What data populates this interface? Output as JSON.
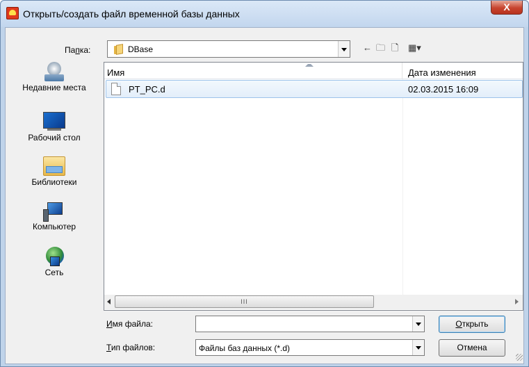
{
  "window": {
    "title": "Открыть/создать файл временной базы данных",
    "close_glyph": "X"
  },
  "lookin": {
    "label_pre": "Па",
    "label_accel": "п",
    "label_post": "ка:",
    "value": "DBase"
  },
  "toolbar": {
    "back_glyph": "←",
    "up_glyph": "🗀",
    "newfolder_glyph": "🗋",
    "views_glyph": "▦▾",
    "icons": [
      "back-icon",
      "up-folder-icon",
      "new-folder-icon",
      "view-menu-icon"
    ]
  },
  "places": [
    {
      "label": "Недавние места",
      "icon": "recent-places-icon"
    },
    {
      "label": "Рабочий стол",
      "icon": "desktop-icon"
    },
    {
      "label": "Библиотеки",
      "icon": "libraries-icon"
    },
    {
      "label": "Компьютер",
      "icon": "computer-icon"
    },
    {
      "label": "Сеть",
      "icon": "network-icon"
    }
  ],
  "filelist": {
    "columns": [
      "Имя",
      "Дата изменения"
    ],
    "rows": [
      {
        "name": "PT_PC.d",
        "date": "02.03.2015 16:09"
      }
    ],
    "scroll_thumb": "III"
  },
  "filename": {
    "label_accel": "И",
    "label_rest": "мя файла:",
    "value": ""
  },
  "filetype": {
    "label_accel": "Т",
    "label_rest": "ип файлов:",
    "value": "Файлы баз данных (*.d)"
  },
  "buttons": {
    "open_accel": "О",
    "open_rest": "ткрыть",
    "cancel": "Отмена"
  },
  "colors": {
    "titlebar": "#c2d6ee",
    "close_button": "#c7442e",
    "selection": "#e3eefa"
  }
}
